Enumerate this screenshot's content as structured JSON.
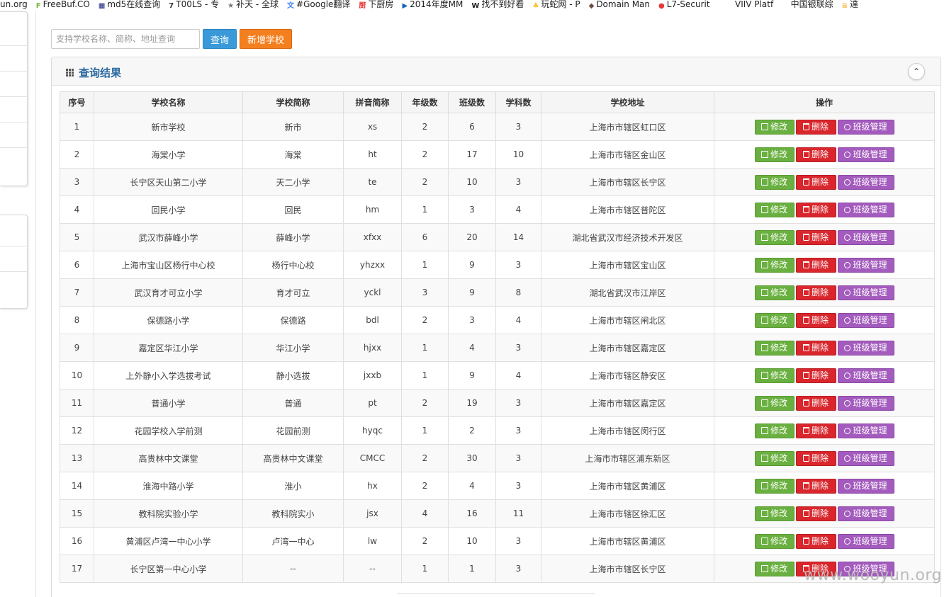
{
  "bookmarks": [
    {
      "label": "un.org",
      "icon": "",
      "color": "#ffffff"
    },
    {
      "label": "FreeBuf.CO",
      "icon": "F",
      "color": "#7cb342"
    },
    {
      "label": "md5在线查询",
      "icon": "▦",
      "color": "#1a237e"
    },
    {
      "label": "T00LS - 专",
      "icon": "7",
      "color": "#333333"
    },
    {
      "label": "补天 - 全球",
      "icon": "★",
      "color": "#777777"
    },
    {
      "label": "#Google翻译",
      "icon": "文",
      "color": "#4285f4"
    },
    {
      "label": "下厨房",
      "icon": "厨",
      "color": "#e53935"
    },
    {
      "label": "2014年度MM",
      "icon": "▶",
      "color": "#1565c0"
    },
    {
      "label": "找不到好看",
      "icon": "W",
      "color": "#212121"
    },
    {
      "label": "玩蛇网 - P",
      "icon": "♣",
      "color": "#fbc02d"
    },
    {
      "label": "Domain Man",
      "icon": "◆",
      "color": "#6d4c41"
    },
    {
      "label": "L7-Securit",
      "icon": "●",
      "color": "#e53935"
    },
    {
      "label": "VIIV Platf",
      "icon": "</>",
      "color": "#ffffff"
    },
    {
      "label": "中国银联综",
      "icon": "▢",
      "color": "#ffffff"
    },
    {
      "label": "達",
      "icon": "≡",
      "color": "#f9a825"
    }
  ],
  "search": {
    "placeholder": "支持学校名称、简称、地址查询",
    "value": ""
  },
  "buttons": {
    "query": "查询",
    "add": "新增学校"
  },
  "panel": {
    "title": "查询结果",
    "collapse_icon": "chevron-up-icon"
  },
  "table": {
    "headers": [
      "序号",
      "学校名称",
      "学校简称",
      "拼音简称",
      "年级数",
      "班级数",
      "学科数",
      "学校地址",
      "操作"
    ],
    "rows": [
      [
        "1",
        "新市学校",
        "新市",
        "xs",
        "2",
        "6",
        "3",
        "上海市市辖区虹口区"
      ],
      [
        "2",
        "海棠小学",
        "海棠",
        "ht",
        "2",
        "17",
        "10",
        "上海市市辖区金山区"
      ],
      [
        "3",
        "长宁区天山第二小学",
        "天二小学",
        "te",
        "2",
        "10",
        "3",
        "上海市市辖区长宁区"
      ],
      [
        "4",
        "回民小学",
        "回民",
        "hm",
        "1",
        "3",
        "4",
        "上海市市辖区普陀区"
      ],
      [
        "5",
        "武汉市薛峰小学",
        "薛峰小学",
        "xfxx",
        "6",
        "20",
        "14",
        "湖北省武汉市经济技术开发区"
      ],
      [
        "6",
        "上海市宝山区杨行中心校",
        "杨行中心校",
        "yhzxx",
        "1",
        "9",
        "3",
        "上海市市辖区宝山区"
      ],
      [
        "7",
        "武汉育才可立小学",
        "育才可立",
        "yckl",
        "3",
        "9",
        "8",
        "湖北省武汉市江岸区"
      ],
      [
        "8",
        "保德路小学",
        "保德路",
        "bdl",
        "2",
        "3",
        "4",
        "上海市市辖区闸北区"
      ],
      [
        "9",
        "嘉定区华江小学",
        "华江小学",
        "hjxx",
        "1",
        "4",
        "3",
        "上海市市辖区嘉定区"
      ],
      [
        "10",
        "上外静小入学选拔考试",
        "静小选拔",
        "jxxb",
        "1",
        "9",
        "4",
        "上海市市辖区静安区"
      ],
      [
        "11",
        "普通小学",
        "普通",
        "pt",
        "2",
        "19",
        "3",
        "上海市市辖区嘉定区"
      ],
      [
        "12",
        "花园学校入学前测",
        "花园前测",
        "hyqc",
        "1",
        "2",
        "3",
        "上海市市辖区闵行区"
      ],
      [
        "13",
        "高贵林中文课堂",
        "高贵林中文课堂",
        "CMCC",
        "2",
        "30",
        "3",
        "上海市市辖区浦东新区"
      ],
      [
        "14",
        "淮海中路小学",
        "淮小",
        "hx",
        "2",
        "4",
        "3",
        "上海市市辖区黄浦区"
      ],
      [
        "15",
        "教科院实验小学",
        "教科院实小",
        "jsx",
        "4",
        "16",
        "11",
        "上海市市辖区徐汇区"
      ],
      [
        "16",
        "黄浦区卢湾一中心小学",
        "卢湾一中心",
        "lw",
        "2",
        "10",
        "3",
        "上海市市辖区黄浦区"
      ],
      [
        "17",
        "长宁区第一中心小学",
        "--",
        "--",
        "1",
        "1",
        "3",
        "上海市市辖区长宁区"
      ]
    ],
    "actions": {
      "edit": "修改",
      "delete": "删除",
      "class_manage": "班级管理"
    }
  },
  "colors": {
    "query_button": "#3a9ad9",
    "add_button": "#f47f1f",
    "edit": "#6ab040",
    "delete": "#d9262c",
    "class_manage": "#a35bbd",
    "panel_title": "#2b6aa0"
  },
  "watermark": "www.wooyun.org"
}
